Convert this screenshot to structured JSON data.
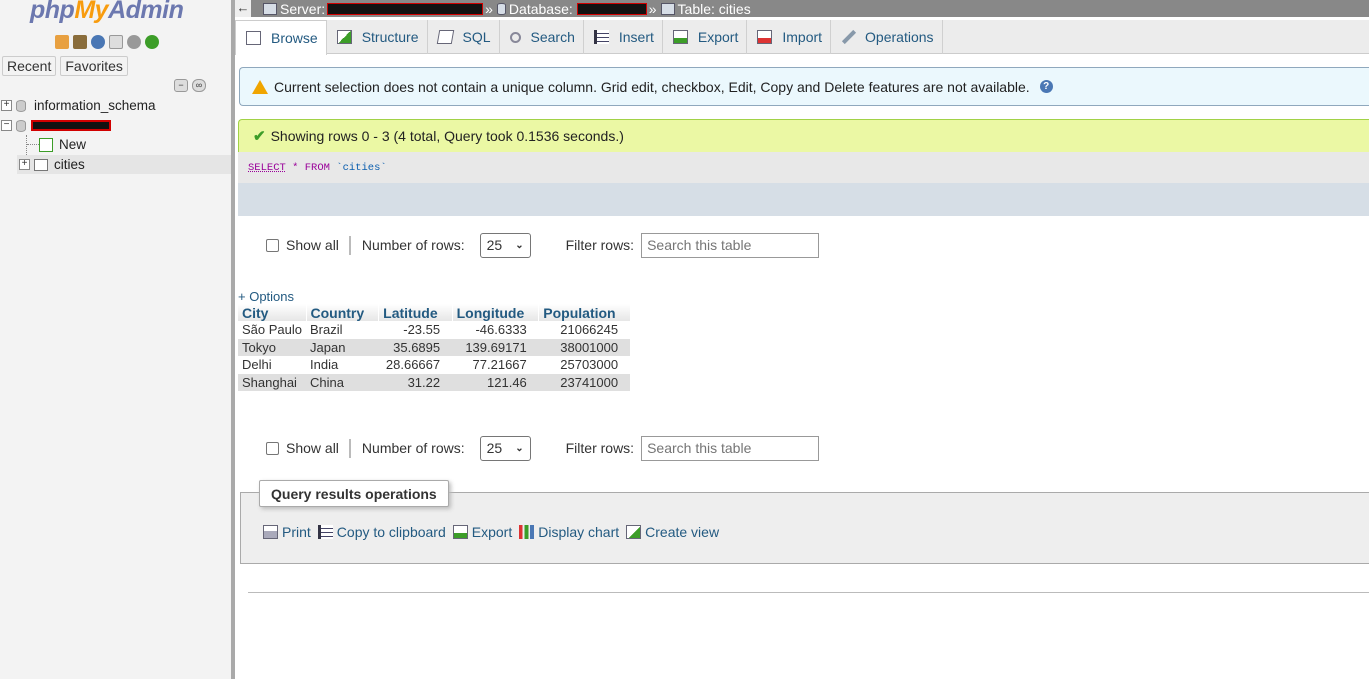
{
  "nav": {
    "logo": {
      "php": "php",
      "my": "My",
      "admin": "Admin"
    },
    "recent_label": "Recent",
    "favorites_label": "Favorites",
    "tree": {
      "db1": "information_schema",
      "new_label": "New",
      "table_label": "cities"
    }
  },
  "breadcrumb": {
    "server_label": "Server:",
    "database_label": "Database:",
    "table_label": "Table: cities",
    "separator": "»"
  },
  "tabs": [
    {
      "label": "Browse",
      "icon": "browse-icon"
    },
    {
      "label": "Structure",
      "icon": "structure-icon"
    },
    {
      "label": "SQL",
      "icon": "sql-icon"
    },
    {
      "label": "Search",
      "icon": "search-icon"
    },
    {
      "label": "Insert",
      "icon": "insert-icon"
    },
    {
      "label": "Export",
      "icon": "export-icon"
    },
    {
      "label": "Import",
      "icon": "import-icon"
    },
    {
      "label": "Operations",
      "icon": "wrench-icon"
    }
  ],
  "notice": {
    "text": "Current selection does not contain a unique column. Grid edit, checkbox, Edit, Copy and Delete features are not available.",
    "help": "?"
  },
  "success": {
    "text": "Showing rows 0 - 3 (4 total, Query took 0.1536 seconds.)"
  },
  "sql": {
    "select": "SELECT",
    "star": "*",
    "from": "FROM",
    "table": "`cities`"
  },
  "navigation": {
    "show_all": "Show all",
    "rows_label": "Number of rows:",
    "rows_value": "25",
    "filter_label": "Filter rows:",
    "filter_placeholder": "Search this table"
  },
  "options_label": "+ Options",
  "table": {
    "headers": [
      "City",
      "Country",
      "Latitude",
      "Longitude",
      "Population"
    ],
    "rows": [
      [
        "São Paulo",
        "Brazil",
        "-23.55",
        "-46.6333",
        "21066245"
      ],
      [
        "Tokyo",
        "Japan",
        "35.6895",
        "139.69171",
        "38001000"
      ],
      [
        "Delhi",
        "India",
        "28.66667",
        "77.21667",
        "25703000"
      ],
      [
        "Shanghai",
        "China",
        "31.22",
        "121.46",
        "23741000"
      ]
    ]
  },
  "operations": {
    "legend": "Query results operations",
    "links": [
      {
        "label": "Print",
        "icon": "print-icon"
      },
      {
        "label": "Copy to clipboard",
        "icon": "clipboard-icon"
      },
      {
        "label": "Export",
        "icon": "export-icon"
      },
      {
        "label": "Display chart",
        "icon": "chart-icon"
      },
      {
        "label": "Create view",
        "icon": "create-view-icon"
      }
    ]
  }
}
